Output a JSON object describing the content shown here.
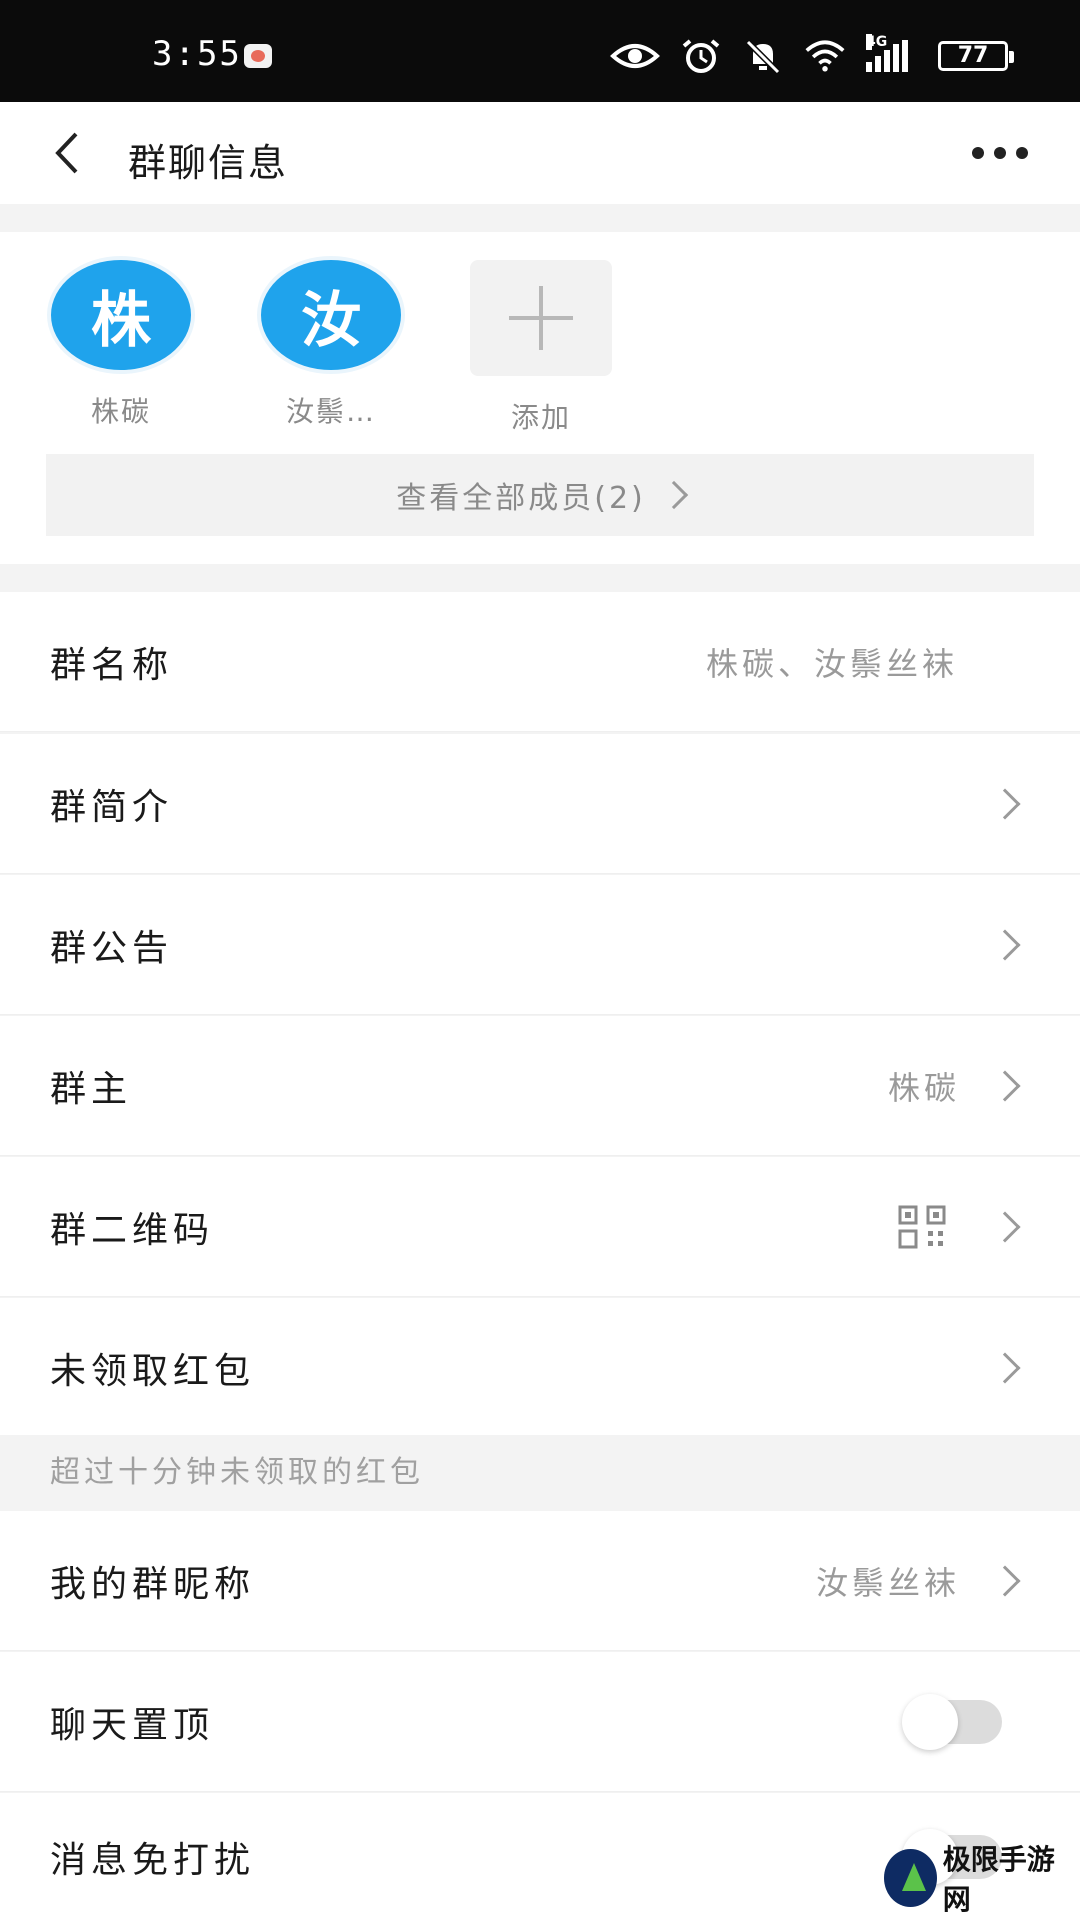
{
  "status_bar": {
    "time": "3:55",
    "network": "4G",
    "battery": "77"
  },
  "header": {
    "title": "群聊信息"
  },
  "members": [
    {
      "avatar_char": "株",
      "name": "株碳"
    },
    {
      "avatar_char": "汝",
      "name": "汝鬃…"
    }
  ],
  "add_label": "添加",
  "view_all_label": "查看全部成员(2)",
  "rows": {
    "group_name": {
      "label": "群名称",
      "value": "株碳、汝鬃丝袜"
    },
    "group_intro": {
      "label": "群简介"
    },
    "group_notice": {
      "label": "群公告"
    },
    "group_owner": {
      "label": "群主",
      "value": "株碳"
    },
    "group_qr": {
      "label": "群二维码"
    },
    "red_packets": {
      "label": "未领取红包"
    },
    "my_nickname": {
      "label": "我的群昵称",
      "value": "汝鬃丝袜"
    },
    "pin_chat": {
      "label": "聊天置顶",
      "on": false
    },
    "mute": {
      "label": "消息免打扰",
      "on": false
    }
  },
  "red_packet_hint": "超过十分钟未领取的红包",
  "watermark": "极限手游网",
  "colors": {
    "accent": "#1fa3ec",
    "status_bar": "#0b0b0b",
    "toggle_off": "#dcdcdc"
  }
}
